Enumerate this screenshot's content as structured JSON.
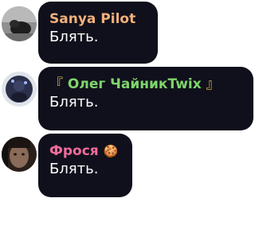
{
  "messages": [
    {
      "author": "Sanya Pilot",
      "author_color": "#f3b07a",
      "text": "Блять."
    },
    {
      "author": "Олег ЧайникTwix",
      "author_prefix": "『",
      "author_suffix": "』",
      "author_color": "#7fd56b",
      "text": "Блять."
    },
    {
      "author": "Фрося",
      "author_emoji": "🍪",
      "author_color": "#f06c9b",
      "text": "Блять."
    }
  ],
  "colors": {
    "bubble": "#10101c",
    "page_background": "#ffffff"
  },
  "icons": [
    "user-avatar-icon",
    "user-avatar-icon",
    "user-avatar-icon",
    "cookie-emoji-icon"
  ]
}
